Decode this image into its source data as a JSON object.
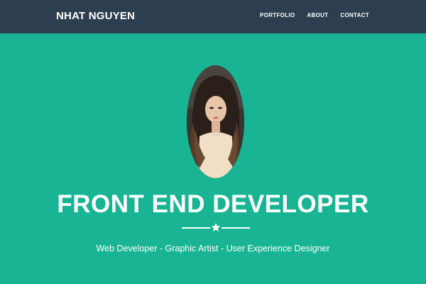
{
  "nav": {
    "brand": "NHAT NGUYEN",
    "links": [
      "PORTFOLIO",
      "ABOUT",
      "CONTACT"
    ]
  },
  "hero": {
    "headline": "FRONT END DEVELOPER",
    "subtitle": "Web Developer - Graphic Artist - User Experience Designer",
    "divider_icon": "star-icon",
    "photo": "profile-photo"
  },
  "colors": {
    "navbar": "#2c3e50",
    "hero_background": "#18b493",
    "text": "#ffffff"
  }
}
